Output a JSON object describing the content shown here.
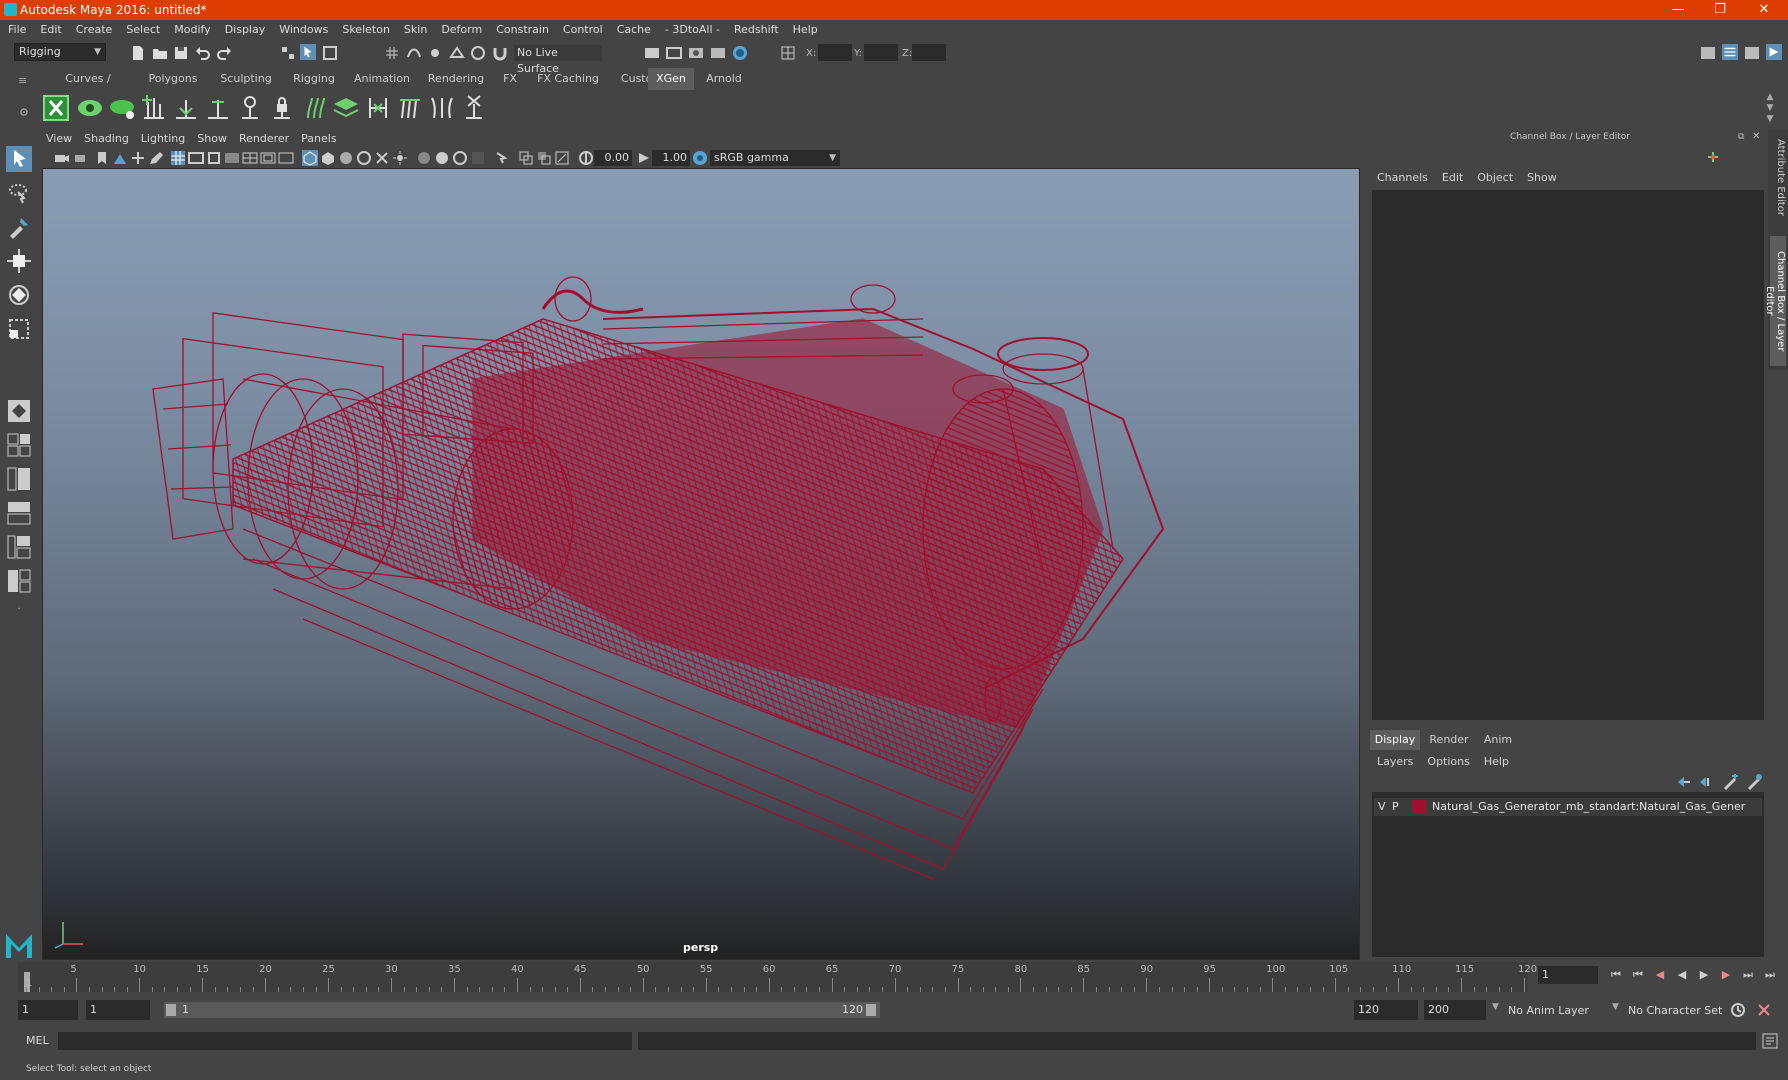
{
  "window": {
    "title": "Autodesk Maya 2016: untitled*"
  },
  "menubar": [
    "File",
    "Edit",
    "Create",
    "Select",
    "Modify",
    "Display",
    "Windows",
    "Skeleton",
    "Skin",
    "Deform",
    "Constrain",
    "Control",
    "Cache",
    "- 3DtoAll -",
    "Redshift",
    "Help"
  ],
  "statusline": {
    "mode": "Rigging",
    "live_surface": "No Live Surface",
    "x_label": "X:",
    "y_label": "Y:",
    "z_label": "Z:"
  },
  "shelf": {
    "tabs": [
      "Curves / Surfaces",
      "Polygons",
      "Sculpting",
      "Rigging",
      "Animation",
      "Rendering",
      "FX",
      "FX Caching",
      "Custom",
      "XGen",
      "Arnold"
    ],
    "active_tab": "XGen"
  },
  "viewport": {
    "menu": [
      "View",
      "Shading",
      "Lighting",
      "Show",
      "Renderer",
      "Panels"
    ],
    "exposure": "0.00",
    "gamma": "1.00",
    "color_space": "sRGB gamma",
    "camera_label": "persp"
  },
  "channel_box": {
    "title": "Channel Box / Layer Editor",
    "menu": [
      "Channels",
      "Edit",
      "Object",
      "Show"
    ]
  },
  "layer_editor": {
    "tabs": [
      "Display",
      "Render",
      "Anim"
    ],
    "active_tab": "Display",
    "menu": [
      "Layers",
      "Options",
      "Help"
    ],
    "layers": [
      {
        "v": "V",
        "p": "P",
        "name": "Natural_Gas_Generator_mb_standart:Natural_Gas_Gener",
        "color": "#a0102e"
      }
    ]
  },
  "side_tabs": [
    "Attribute Editor",
    "Channel Box / Layer Editor"
  ],
  "timeslider": {
    "ticks": [
      "5",
      "10",
      "15",
      "20",
      "25",
      "30",
      "35",
      "40",
      "45",
      "50",
      "55",
      "60",
      "65",
      "70",
      "75",
      "80",
      "85",
      "90",
      "95",
      "100",
      "105",
      "110",
      "115",
      "120"
    ],
    "start_label": "1",
    "current_frame": "1"
  },
  "range": {
    "start": "1",
    "playback_start": "1",
    "slider_start": "1",
    "slider_end": "120",
    "playback_end": "120",
    "end": "200",
    "anim_layer": "No Anim Layer",
    "character_set": "No Character Set"
  },
  "cmdline": {
    "label": "MEL"
  },
  "helpline": {
    "text": "Select Tool: select an object"
  },
  "colors": {
    "titlebar": "#dd3e00",
    "wireframe": "#a0102e",
    "accent": "#23b5c9"
  }
}
